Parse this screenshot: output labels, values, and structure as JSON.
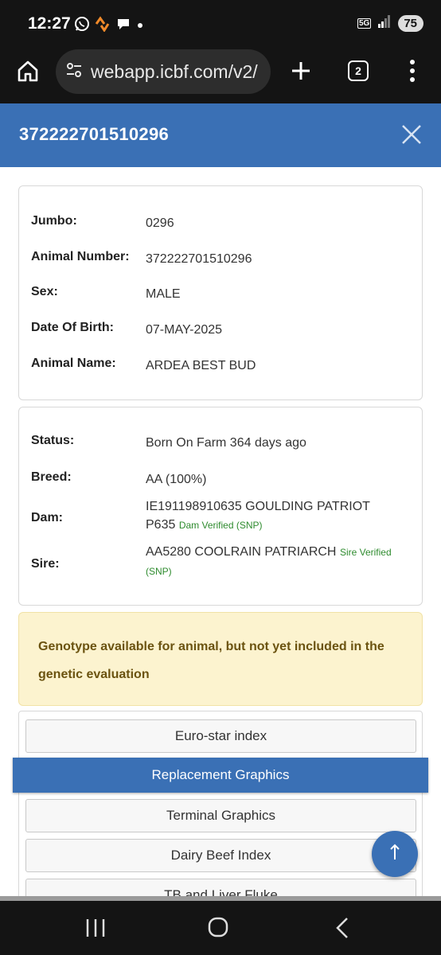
{
  "status_bar": {
    "time": "12:27",
    "network": "5G",
    "battery": "75",
    "left_icons": [
      "whatsapp-icon",
      "strava-icon",
      "chat-icon",
      "dot-icon"
    ],
    "right_icons": [
      "5g-icon",
      "signal-icon",
      "battery-icon"
    ]
  },
  "browser": {
    "url": "webapp.icbf.com/v2/",
    "tab_count": "2",
    "icons": [
      "home-icon",
      "site-settings-icon",
      "new-tab-icon",
      "tab-switcher-icon",
      "menu-icon"
    ]
  },
  "modal": {
    "title": "372222701510296",
    "close_icon": "close-icon"
  },
  "identity": {
    "rows": [
      {
        "label": "Jumbo:",
        "value": "0296"
      },
      {
        "label": "Animal Number:",
        "value": "372222701510296"
      },
      {
        "label": "Sex:",
        "value": "MALE"
      },
      {
        "label": "Date Of Birth:",
        "value": "07-MAY-2025"
      },
      {
        "label": "Animal Name:",
        "value": "ARDEA BEST BUD"
      }
    ]
  },
  "pedigree": {
    "status": {
      "label": "Status:",
      "value": "Born On Farm 364 days ago"
    },
    "breed": {
      "label": "Breed:",
      "value": "AA (100%)"
    },
    "dam": {
      "label": "Dam:",
      "value": "IE191198910635 GOULDING PATRIOT P635",
      "verified": "Dam Verified (SNP)"
    },
    "sire": {
      "label": "Sire:",
      "value": "AA5280 COOLRAIN PATRIARCH",
      "verified": "Sire Verified (SNP)"
    }
  },
  "alert": {
    "text": "Genotype available for animal, but not yet included in the genetic evaluation"
  },
  "sections": {
    "items": [
      "Euro-star index",
      "Replacement Graphics",
      "Terminal Graphics",
      "Dairy Beef Index",
      "TB and Liver Fluke"
    ],
    "active": "Replacement Graphics"
  },
  "fab": {
    "icon": "arrow-up-icon"
  },
  "nav": {
    "icons": [
      "recents-icon",
      "home-circle-icon",
      "back-icon"
    ]
  },
  "colors": {
    "primary": "#3a70b5",
    "alert_bg": "#fcf3cf",
    "alert_text": "#6b5310",
    "verified": "#2e8b2e"
  }
}
